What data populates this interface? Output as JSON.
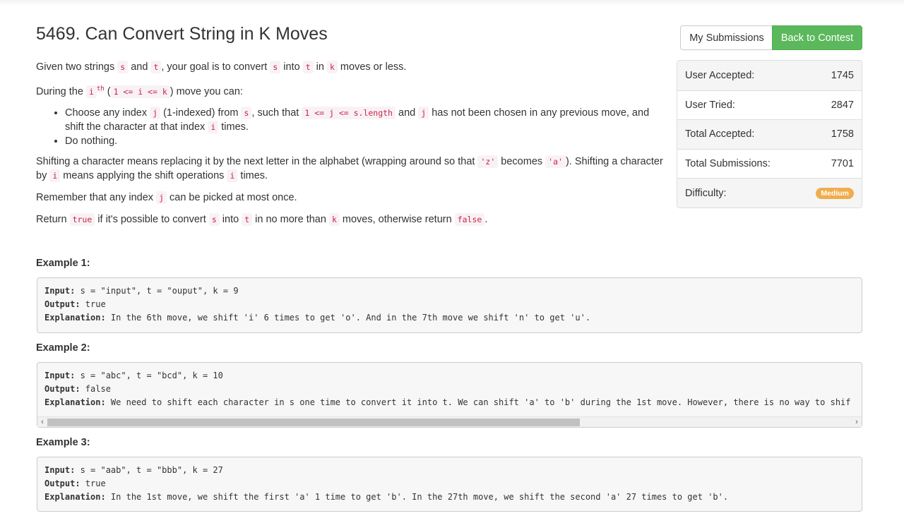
{
  "problem": {
    "title": "5469. Can Convert String in K Moves"
  },
  "header_buttons": {
    "my_submissions": "My Submissions",
    "back_to_contest": "Back to Contest"
  },
  "stats": [
    {
      "label": "User Accepted:",
      "value": "1745"
    },
    {
      "label": "User Tried:",
      "value": "2847"
    },
    {
      "label": "Total Accepted:",
      "value": "1758"
    },
    {
      "label": "Total Submissions:",
      "value": "7701"
    },
    {
      "label": "Difficulty:",
      "value": "Medium"
    }
  ],
  "difficulty_color": "#f0ad4e",
  "accent_color": "#5cb85c",
  "description": {
    "p1": {
      "t1": "Given two strings ",
      "c1": "s",
      "t2": " and ",
      "c2": "t",
      "t3": ", your goal is to convert ",
      "c3": "s",
      "t4": " into ",
      "c4": "t",
      "t5": " in ",
      "c5": "k",
      "t6": " moves or less."
    },
    "p2": {
      "t1": "During the ",
      "c1": "i",
      "sup": "th",
      "t2": " (",
      "c2": "1 <= i <= k",
      "t3": ") move you can:"
    },
    "bullet1": {
      "t1": "Choose any index ",
      "c1": "j",
      "t2": " (1-indexed) from ",
      "c2": "s",
      "t3": ", such that ",
      "c3": "1 <= j <= s.length",
      "t4": " and ",
      "c4": "j",
      "t5": " has not been chosen in any previous move, and shift the character at that index ",
      "c5": "i",
      "t6": " times."
    },
    "bullet2": "Do nothing.",
    "p3": {
      "t1": "Shifting a character means replacing it by the next letter in the alphabet (wrapping around so that ",
      "c1": "'z'",
      "t2": " becomes ",
      "c2": "'a'",
      "t3": "). Shifting a character by ",
      "c3": "i",
      "t4": " means applying the shift operations ",
      "c4": "i",
      "t5": " times."
    },
    "p4": {
      "t1": "Remember that any index ",
      "c1": "j",
      "t2": " can be picked at most once."
    },
    "p5": {
      "t1": "Return ",
      "c1": "true",
      "t2": " if it's possible to convert ",
      "c2": "s",
      "t3": " into ",
      "c3": "t",
      "t4": " in no more than ",
      "c4": "k",
      "t5": " moves, otherwise return ",
      "c5": "false",
      "t6": "."
    }
  },
  "examples": [
    {
      "heading": "Example 1:",
      "input_label": "Input:",
      "input": " s = \"input\", t = \"ouput\", k = 9",
      "output_label": "Output:",
      "output": " true",
      "explanation_label": "Explanation:",
      "explanation": " In the 6th move, we shift 'i' 6 times to get 'o'. And in the 7th move we shift 'n' to get 'u'."
    },
    {
      "heading": "Example 2:",
      "input_label": "Input:",
      "input": " s = \"abc\", t = \"bcd\", k = 10",
      "output_label": "Output:",
      "output": " false",
      "explanation_label": "Explanation:",
      "explanation": " We need to shift each character in s one time to convert it into t. We can shift 'a' to 'b' during the 1st move. However, there is no way to shif"
    },
    {
      "heading": "Example 3:",
      "input_label": "Input:",
      "input": " s = \"aab\", t = \"bbb\", k = 27",
      "output_label": "Output:",
      "output": " true",
      "explanation_label": "Explanation:",
      "explanation": " In the 1st move, we shift the first 'a' 1 time to get 'b'. In the 27th move, we shift the second 'a' 27 times to get 'b'."
    }
  ],
  "scroll": {
    "left_arrow": "‹",
    "right_arrow": "›"
  }
}
